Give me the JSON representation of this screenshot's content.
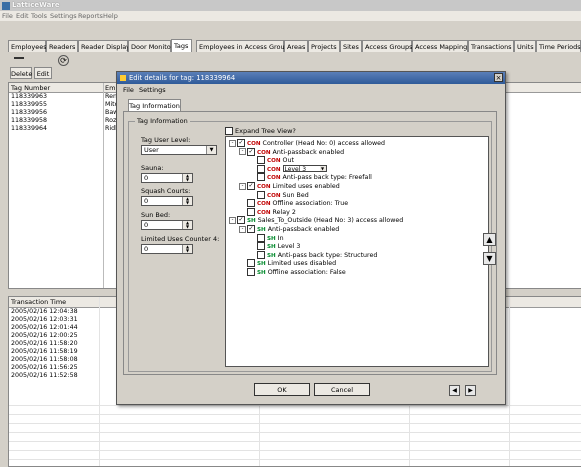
{
  "app": {
    "title": "LatticeWare"
  },
  "menu": [
    "File",
    "Edit",
    "Tools",
    "Settings",
    "Reports",
    "Help"
  ],
  "tabs": [
    "Employees",
    "Readers",
    "Reader Display",
    "Door Monitor",
    "Tags",
    "Employees in Access Groups",
    "Areas",
    "Projects",
    "Sites",
    "Access Groups",
    "Access Mapping",
    "Transactions",
    "Units",
    "Time Periods"
  ],
  "toolbar": {
    "delete_label": "Delete",
    "edit_label": "Edit"
  },
  "tag_grid": {
    "headers": [
      "Tag Number",
      "Emp"
    ],
    "rows": [
      [
        "118339963",
        "Rens"
      ],
      [
        "118339955",
        "Mitch"
      ],
      [
        "118339956",
        "Baw,"
      ],
      [
        "118339958",
        "Rozo"
      ],
      [
        "118339964",
        "Ridle"
      ]
    ]
  },
  "transactions": {
    "header": "Transaction Time",
    "rows": [
      "2005/02/16 12:04:38",
      "2005/02/16 12:03:31",
      "2005/02/16 12:01:44",
      "2005/02/16 12:00:25",
      "2005/02/16 11:58:20",
      "2005/02/16 11:58:19",
      "2005/02/16 11:58:08",
      "2005/02/16 11:56:25",
      "2005/02/16 11:52:58"
    ]
  },
  "dialog": {
    "title": "Edit details for tag: 118339964",
    "menu": [
      "File",
      "Settings"
    ],
    "tab": "Tag Information",
    "group_label": "Tag Information",
    "user_level_label": "Tag User Level:",
    "user_level_value": "User",
    "fields": [
      {
        "label": "Sauna:",
        "value": "0"
      },
      {
        "label": "Squash Courts:",
        "value": "0"
      },
      {
        "label": "Sun Bed:",
        "value": "0"
      },
      {
        "label": "Limited Uses Counter 4:",
        "value": "0"
      }
    ],
    "expand_label": "Expand Tree View?",
    "ok_label": "OK",
    "cancel_label": "Cancel"
  },
  "tree": [
    {
      "level": 0,
      "pm": "-",
      "check": "✓",
      "tag": "CON",
      "text": "Controller (Head No: 0) access allowed"
    },
    {
      "level": 1,
      "pm": "-",
      "check": "✓",
      "tag": "CON",
      "text": "Anti-passback enabled"
    },
    {
      "level": 2,
      "pm": "",
      "check": "",
      "tag": "CON",
      "text": "Out"
    },
    {
      "level": 2,
      "pm": "",
      "check": "",
      "tag": "CON",
      "text": "Level 3",
      "select": true
    },
    {
      "level": 2,
      "pm": "",
      "check": "",
      "tag": "CON",
      "text": "Anti-pass back type: Freefall"
    },
    {
      "level": 1,
      "pm": "-",
      "check": "✓",
      "tag": "CON",
      "text": "Limited uses enabled"
    },
    {
      "level": 2,
      "pm": "",
      "check": "",
      "tag": "CON",
      "text": "Sun Bed"
    },
    {
      "level": 1,
      "pm": "",
      "check": "",
      "tag": "CON",
      "text": "Offline association: True"
    },
    {
      "level": 1,
      "pm": "",
      "check": "",
      "tag": "CON",
      "text": "Relay 2"
    },
    {
      "level": 0,
      "pm": "-",
      "check": "✓",
      "tag": "SH",
      "text": "Sales_To_Outside (Head No: 3) access allowed"
    },
    {
      "level": 1,
      "pm": "-",
      "check": "✓",
      "tag": "SH",
      "text": "Anti-passback enabled"
    },
    {
      "level": 2,
      "pm": "",
      "check": "",
      "tag": "SH",
      "text": "In"
    },
    {
      "level": 2,
      "pm": "",
      "check": "",
      "tag": "SH",
      "text": "Level 3"
    },
    {
      "level": 2,
      "pm": "",
      "check": "",
      "tag": "SH",
      "text": "Anti-pass back type: Structured"
    },
    {
      "level": 1,
      "pm": "",
      "check": "",
      "tag": "SH",
      "text": "Limited uses disabled"
    },
    {
      "level": 1,
      "pm": "",
      "check": "",
      "tag": "SH",
      "text": "Offline association: False"
    }
  ],
  "icons": {
    "delete": "minus-icon",
    "edit": "edit-icon",
    "refresh": "refresh-icon",
    "close": "close-icon",
    "up": "up-arrow-icon",
    "down": "down-arrow-icon",
    "prev": "prev-icon",
    "next": "next-icon"
  }
}
